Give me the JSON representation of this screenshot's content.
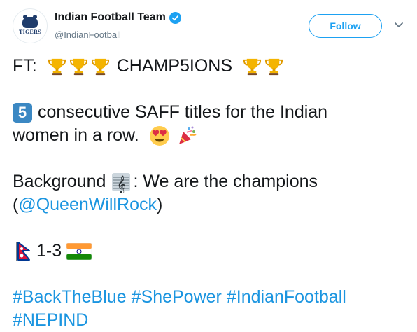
{
  "user": {
    "display_name": "Indian Football Team",
    "handle": "@IndianFootball",
    "avatar_text": "TIGERS",
    "verified": true
  },
  "follow_label": "Follow",
  "tweet": {
    "line1": {
      "prefix": "FT:",
      "suffix": "CHAMP5IONS"
    },
    "line2": {
      "number": "5",
      "text": "consecutive SAFF titles for the Indian"
    },
    "line3": {
      "text": "women in a row."
    },
    "line4": {
      "prefix": "Background",
      "suffix": ": We are the champions"
    },
    "line5": {
      "open": "(",
      "mention": "@QueenWillRock",
      "close": ")"
    },
    "line6": {
      "score": "1-3"
    },
    "hashtags": [
      "#BackTheBlue",
      "#ShePower",
      "#IndianFootball",
      "#NEPIND"
    ]
  },
  "icons": [
    "trophy-icon",
    "keycap-five-icon",
    "heart-eyes-icon",
    "party-popper-icon",
    "musical-score-icon",
    "nepal-flag-icon",
    "india-flag-icon",
    "verified-badge-icon",
    "chevron-down-icon"
  ],
  "colors": {
    "link": "#1b95e0",
    "follow": "#1da1f2",
    "text": "#14171a",
    "muted": "#657786"
  }
}
